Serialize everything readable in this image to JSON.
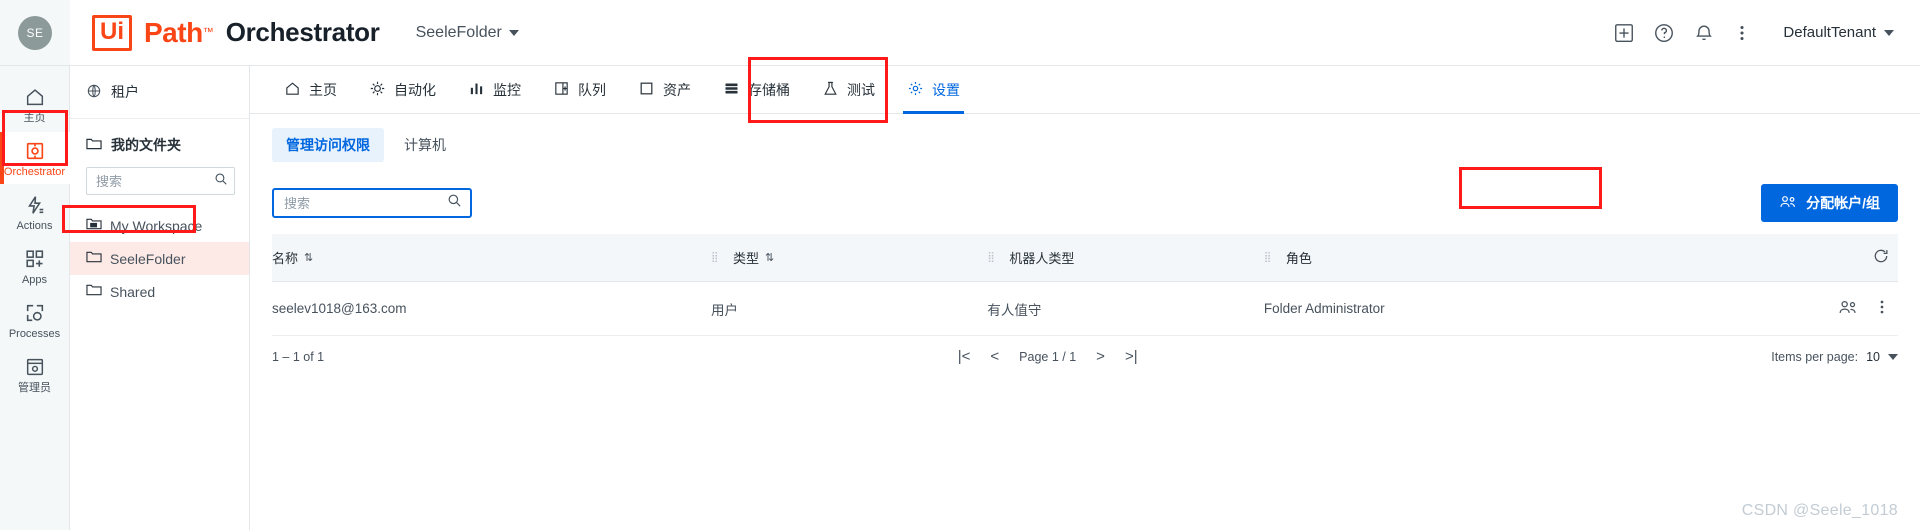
{
  "header": {
    "avatar_initials": "SE",
    "logo_ui": "Ui",
    "logo_path": "Path",
    "logo_tm": "™",
    "product": "Orchestrator",
    "folder_selector": "SeeleFolder",
    "tenant": "DefaultTenant",
    "icons": {
      "apps_grid": "apps-grid-icon",
      "help": "help-icon",
      "notifications": "bell-icon",
      "more": "more-vertical-icon"
    }
  },
  "rail": {
    "items": [
      {
        "label": "主页",
        "icon": "home-icon",
        "name": "home",
        "active": false
      },
      {
        "label": "Orchestrator",
        "icon": "orchestrator-icon",
        "name": "orchestrator",
        "active": true
      },
      {
        "label": "Actions",
        "icon": "actions-icon",
        "name": "actions",
        "active": false
      },
      {
        "label": "Apps",
        "icon": "apps-icon",
        "name": "apps",
        "active": false
      },
      {
        "label": "Processes",
        "icon": "processes-icon",
        "name": "processes",
        "active": false
      },
      {
        "label": "管理员",
        "icon": "admin-icon",
        "name": "admin",
        "active": false
      }
    ]
  },
  "folder_pane": {
    "tenant_label": "租户",
    "my_folders_label": "我的文件夹",
    "search_placeholder": "搜索",
    "search_value": "",
    "items": [
      {
        "label": "My Workspace",
        "icon": "workspace-folder-icon",
        "selected": false
      },
      {
        "label": "SeeleFolder",
        "icon": "folder-icon",
        "selected": true
      },
      {
        "label": "Shared",
        "icon": "folder-icon",
        "selected": false
      }
    ]
  },
  "nav_tabs": [
    {
      "label": "主页",
      "icon": "home-icon",
      "active": false
    },
    {
      "label": "自动化",
      "icon": "automation-icon",
      "active": false
    },
    {
      "label": "监控",
      "icon": "monitoring-icon",
      "active": false
    },
    {
      "label": "队列",
      "icon": "queues-icon",
      "active": false
    },
    {
      "label": "资产",
      "icon": "assets-icon",
      "active": false
    },
    {
      "label": "存储桶",
      "icon": "buckets-icon",
      "active": false
    },
    {
      "label": "测试",
      "icon": "testing-icon",
      "active": false
    },
    {
      "label": "设置",
      "icon": "settings-gear-icon",
      "active": true
    }
  ],
  "sub_tabs": [
    {
      "label": "管理访问权限",
      "active": true
    },
    {
      "label": "计算机",
      "active": false
    }
  ],
  "toolbar": {
    "search_placeholder": "搜索",
    "search_value": "",
    "assign_label": "分配帐户/组",
    "assign_icon": "assign-users-icon"
  },
  "table": {
    "columns": [
      "名称",
      "类型",
      "机器人类型",
      "角色"
    ],
    "sortable": [
      true,
      true,
      false,
      false
    ],
    "rows": [
      {
        "name": "seelev1018@163.com",
        "type": "用户",
        "robot_type": "有人值守",
        "role": "Folder Administrator"
      }
    ],
    "refresh_icon": "refresh-icon",
    "row_icons": {
      "edit": "manage-users-icon",
      "more": "more-vertical-icon"
    }
  },
  "pagination": {
    "range": "1 – 1 of 1",
    "first": "|<",
    "prev": "<",
    "page_label": "Page 1 / 1",
    "next": ">",
    "last": ">|",
    "items_per_page_label": "Items per page:",
    "items_per_page_value": "10"
  },
  "watermark": "CSDN @Seele_1018",
  "colors": {
    "brand_orange": "#fa4616",
    "accent_blue": "#0067df",
    "annotation_red": "#ff1a1a"
  }
}
